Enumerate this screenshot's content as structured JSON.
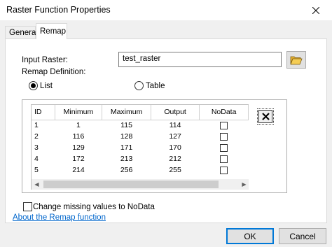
{
  "window": {
    "title": "Raster Function Properties"
  },
  "tabs": [
    {
      "label": "General",
      "active": false
    },
    {
      "label": "Remap",
      "active": true
    }
  ],
  "form": {
    "input_raster_label": "Input Raster:",
    "input_raster_value": "test_raster",
    "remap_definition_label": "Remap Definition:",
    "radio_list_label": "List",
    "radio_table_label": "Table",
    "selected_mode": "List"
  },
  "table": {
    "columns": [
      "ID",
      "Minimum",
      "Maximum",
      "Output",
      "NoData"
    ],
    "rows": [
      {
        "id": "1",
        "min": "1",
        "max": "115",
        "output": "114",
        "nodata": false
      },
      {
        "id": "2",
        "min": "116",
        "max": "128",
        "output": "127",
        "nodata": false
      },
      {
        "id": "3",
        "min": "129",
        "max": "171",
        "output": "170",
        "nodata": false
      },
      {
        "id": "4",
        "min": "172",
        "max": "213",
        "output": "212",
        "nodata": false
      },
      {
        "id": "5",
        "min": "214",
        "max": "256",
        "output": "255",
        "nodata": false
      }
    ]
  },
  "change_missing_label": "Change missing values to NoData",
  "change_missing_checked": false,
  "about_link": "About the Remap function",
  "buttons": {
    "ok": "OK",
    "cancel": "Cancel"
  },
  "icons": {
    "close": "close-icon",
    "browse": "open-folder-icon",
    "delete": "delete-x-icon",
    "scroll_left": "chevron-left-icon",
    "scroll_right": "chevron-right-icon"
  }
}
